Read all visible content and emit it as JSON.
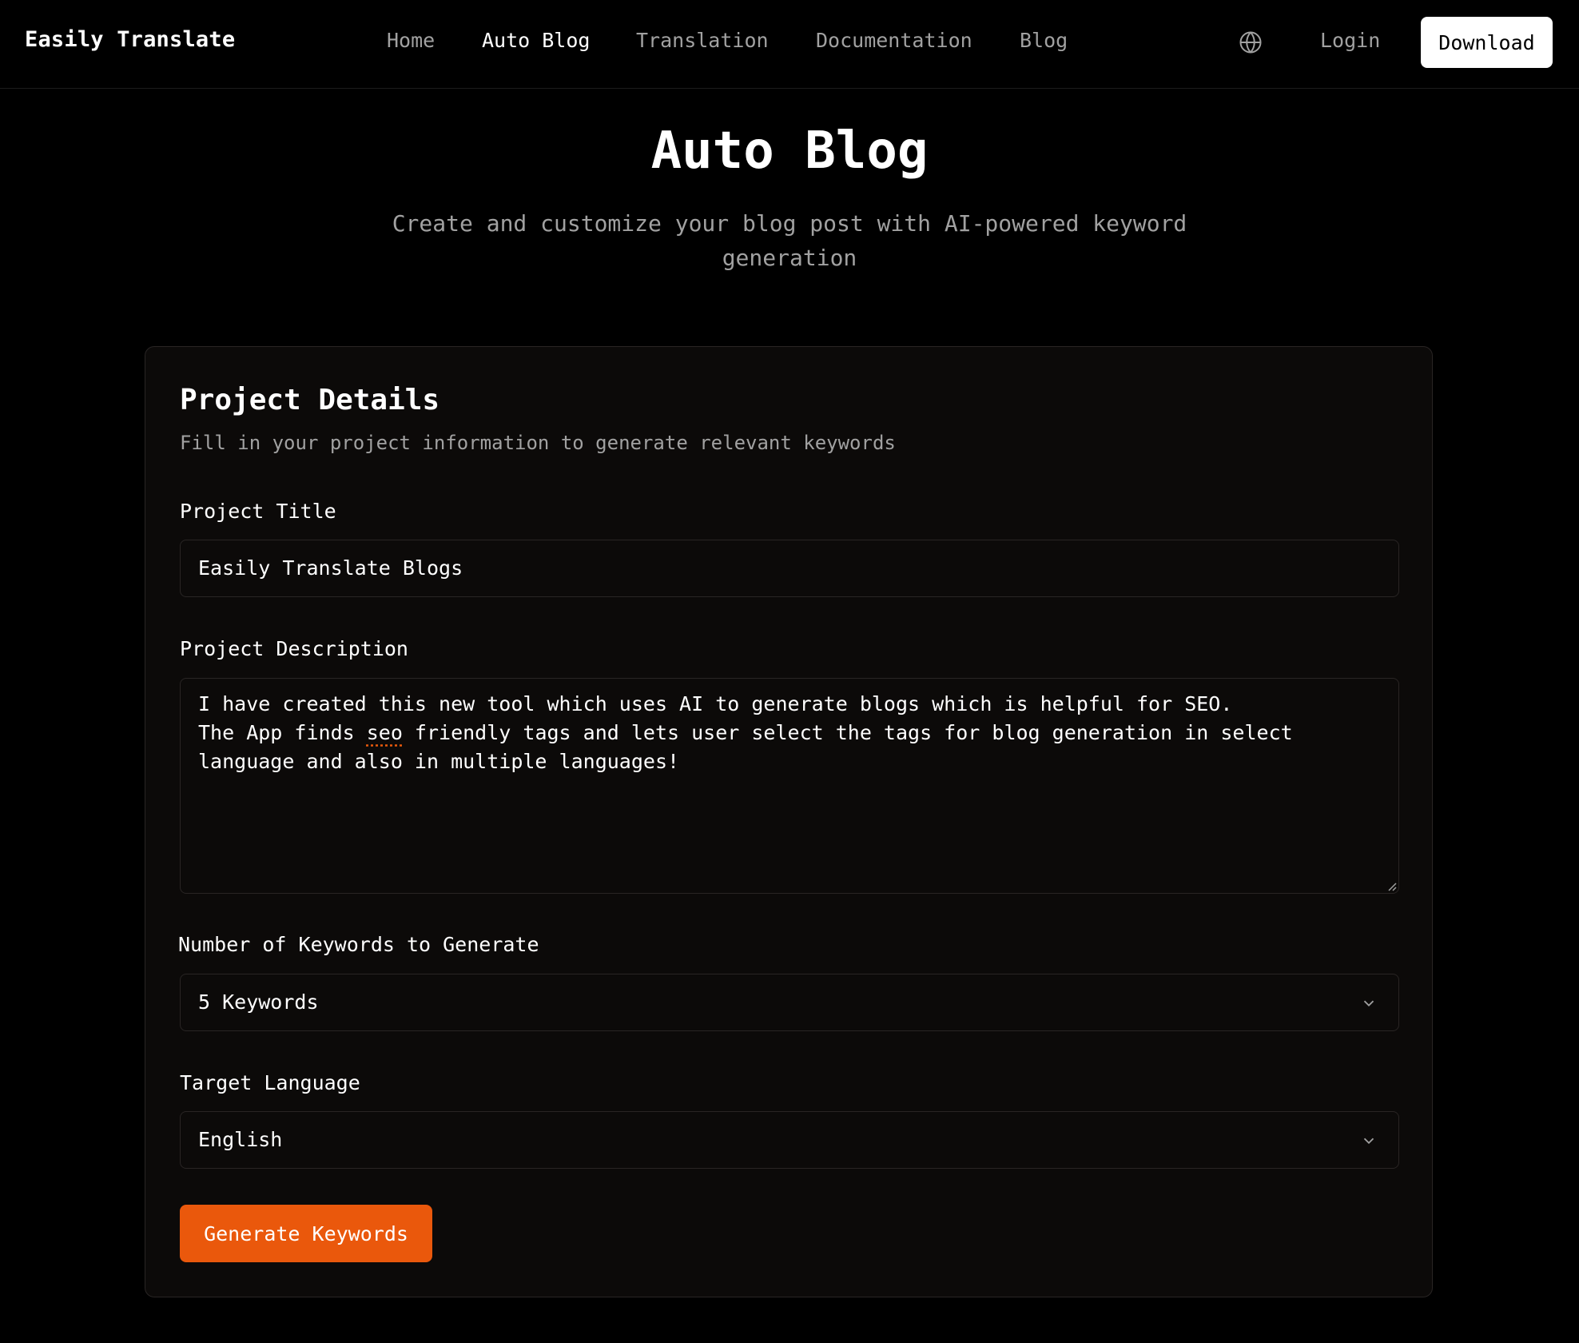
{
  "header": {
    "brand": "Easily Translate",
    "nav": [
      {
        "label": "Home",
        "active": false
      },
      {
        "label": "Auto Blog",
        "active": true
      },
      {
        "label": "Translation",
        "active": false
      },
      {
        "label": "Documentation",
        "active": false
      },
      {
        "label": "Blog",
        "active": false
      }
    ],
    "language_icon": "globe-icon",
    "login_label": "Login",
    "download_label": "Download"
  },
  "hero": {
    "title": "Auto Blog",
    "subtitle": "Create and customize your blog post with AI-powered keyword generation"
  },
  "card": {
    "title": "Project Details",
    "description": "Fill in your project information to generate relevant keywords",
    "project_title": {
      "label": "Project Title",
      "value": "Easily Translate Blogs"
    },
    "project_description": {
      "label": "Project Description",
      "line1": "I have created this new tool which uses AI to generate blogs which is helpful for SEO.",
      "line2_before": "The App finds ",
      "line2_misspelled": "seo",
      "line2_after": " friendly tags and lets user select the tags for blog generation in select",
      "line3": "language and also in multiple languages!"
    },
    "keyword_count": {
      "label": "Number of Keywords to Generate",
      "selected": "5 Keywords"
    },
    "target_language": {
      "label": "Target Language",
      "selected": "English"
    },
    "generate_label": "Generate Keywords"
  },
  "colors": {
    "background": "#000000",
    "card_background": "#0c0a09",
    "border": "#292524",
    "muted_text": "#a1a1a1",
    "accent": "#ea580c"
  }
}
